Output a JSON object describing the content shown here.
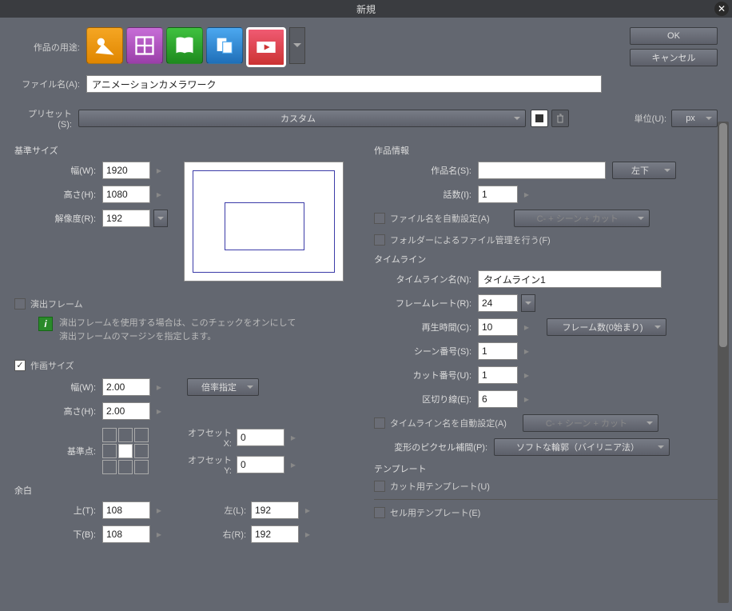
{
  "titlebar": {
    "title": "新規"
  },
  "buttons": {
    "ok": "OK",
    "cancel": "キャンセル"
  },
  "labels": {
    "purpose": "作品の用途:",
    "filename": "ファイル名(A):",
    "preset": "プリセット(S):",
    "unit": "単位(U):"
  },
  "filename_value": "アニメーションカメラワーク",
  "preset_value": "カスタム",
  "unit_value": "px",
  "left": {
    "base_size": "基準サイズ",
    "width_l": "幅(W):",
    "width_v": "1920",
    "height_l": "高さ(H):",
    "height_v": "1080",
    "res_l": "解像度(R):",
    "res_v": "192",
    "direction_frame": "演出フレーム",
    "direction_hint": "演出フレームを使用する場合は、このチェックをオンにして\n演出フレームのマージンを指定します。",
    "draw_size": "作画サイズ",
    "dw_l": "幅(W):",
    "dw_v": "2.00",
    "dh_l": "高さ(H):",
    "dh_v": "2.00",
    "scale_btn": "倍率指定",
    "anchor_l": "基準点:",
    "offx_l": "オフセットX:",
    "offx_v": "0",
    "offy_l": "オフセットY:",
    "offy_v": "0",
    "margin": "余白",
    "top_l": "上(T):",
    "top_v": "108",
    "bottom_l": "下(B):",
    "bottom_v": "108",
    "left_l": "左(L):",
    "left_v": "192",
    "right_l": "右(R):",
    "right_v": "192"
  },
  "right": {
    "work_info": "作品情報",
    "work_name_l": "作品名(S):",
    "work_name_v": "",
    "pos_btn": "左下",
    "ep_l": "話数(I):",
    "ep_v": "1",
    "auto_fn": "ファイル名を自動設定(A)",
    "auto_fn_fmt": "C- + シーン + カット",
    "folder_mgmt": "フォルダーによるファイル管理を行う(F)",
    "timeline": "タイムライン",
    "tl_name_l": "タイムライン名(N):",
    "tl_name_v": "タイムライン1",
    "fps_l": "フレームレート(R):",
    "fps_v": "24",
    "play_l": "再生時間(C):",
    "play_v": "10",
    "frame_count_btn": "フレーム数(0始まり)",
    "scene_l": "シーン番号(S):",
    "scene_v": "1",
    "cut_l": "カット番号(U):",
    "cut_v": "1",
    "div_l": "区切り線(E):",
    "div_v": "6",
    "auto_tl": "タイムライン名を自動設定(A)",
    "auto_tl_fmt": "C- + シーン + カット",
    "pixcomp_l": "変形のピクセル補間(P):",
    "pixcomp_v": "ソフトな輪郭（バイリニア法）",
    "template": "テンプレート",
    "cut_tmpl": "カット用テンプレート(U)",
    "cel_tmpl": "セル用テンプレート(E)"
  }
}
